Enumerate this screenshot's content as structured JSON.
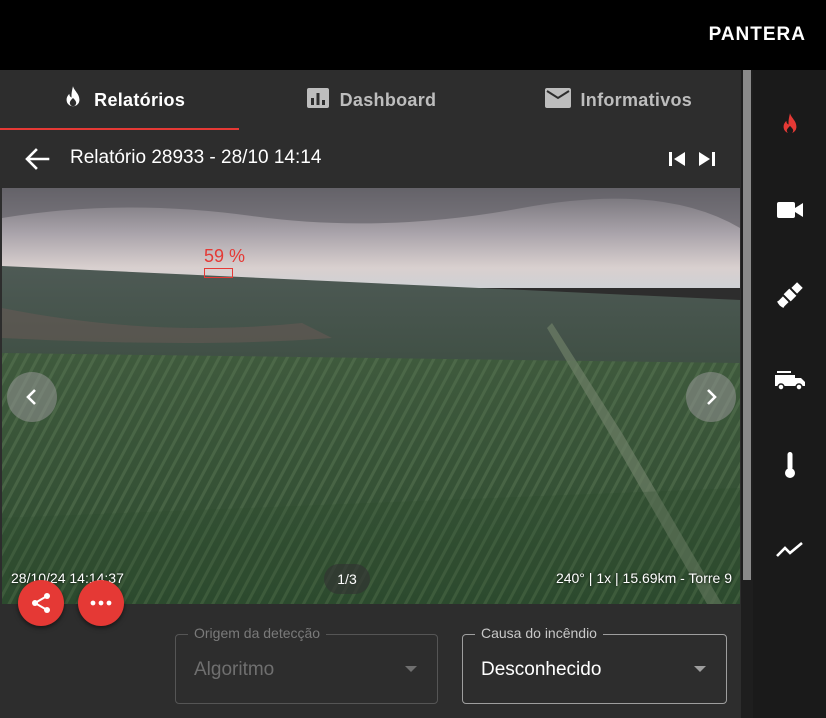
{
  "app": {
    "brand": "PANTERA"
  },
  "tabs": [
    {
      "label": "Relatórios",
      "icon": "flame-icon",
      "active": true
    },
    {
      "label": "Dashboard",
      "icon": "chart-icon",
      "active": false
    },
    {
      "label": "Informativos",
      "icon": "mail-icon",
      "active": false
    }
  ],
  "header": {
    "title": "Relatório 28933 - 28/10 14:14"
  },
  "photo": {
    "timestamp": "28/10/24 14:14:37",
    "counter": "1/3",
    "info": "240° | 1x | 15.69km - Torre 9",
    "detection_confidence": "59 %"
  },
  "form": {
    "origin": {
      "label": "Origem da detecção",
      "value": "Algoritmo"
    },
    "cause": {
      "label": "Causa do incêndio",
      "value": "Desconhecido"
    }
  },
  "rail": [
    "flame-icon",
    "camera-icon",
    "satellite-icon",
    "fire-truck-icon",
    "thermometer-icon",
    "trend-icon"
  ],
  "colors": {
    "accent": "#e53935",
    "panel": "#2d2d2d",
    "rail": "#1a1a1a"
  }
}
